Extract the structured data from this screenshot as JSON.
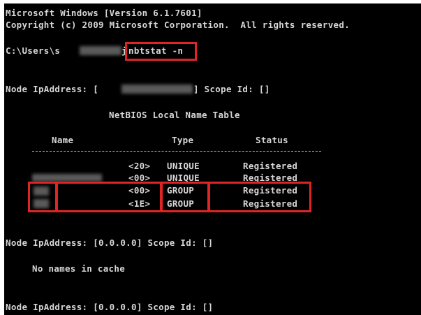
{
  "console": {
    "header_line1": "Microsoft Windows [Version 6.1.7601]",
    "header_line2": "Copyright (c) 2009 Microsoft Corporation.  All rights reserved.",
    "prompt_prefix": "C:\\Users\\s",
    "prompt_suffix": "j",
    "command": "nbtstat -n"
  },
  "node1": {
    "label": "Node IpAddress: [",
    "scope": "] Scope Id: []"
  },
  "table": {
    "title": "NetBIOS Local Name Table",
    "headers": {
      "name": "Name",
      "type": "Type",
      "status": "Status"
    },
    "rows": [
      {
        "suffix": "<20>",
        "type": "UNIQUE",
        "status": "Registered"
      },
      {
        "suffix": "<00>",
        "type": "UNIQUE",
        "status": "Registered"
      },
      {
        "suffix": "<00>",
        "type": "GROUP",
        "status": "Registered"
      },
      {
        "suffix": "<1E>",
        "type": "GROUP",
        "status": "Registered"
      }
    ]
  },
  "node2": {
    "line": "Node IpAddress: [0.0.0.0] Scope Id: []"
  },
  "cache": {
    "message": "No names in cache"
  },
  "node3": {
    "line": "Node IpAddress: [0.0.0.0] Scope Id: []"
  },
  "colors": {
    "background": "#000000",
    "text": "#d6d6d6",
    "highlight": "#e02424"
  }
}
